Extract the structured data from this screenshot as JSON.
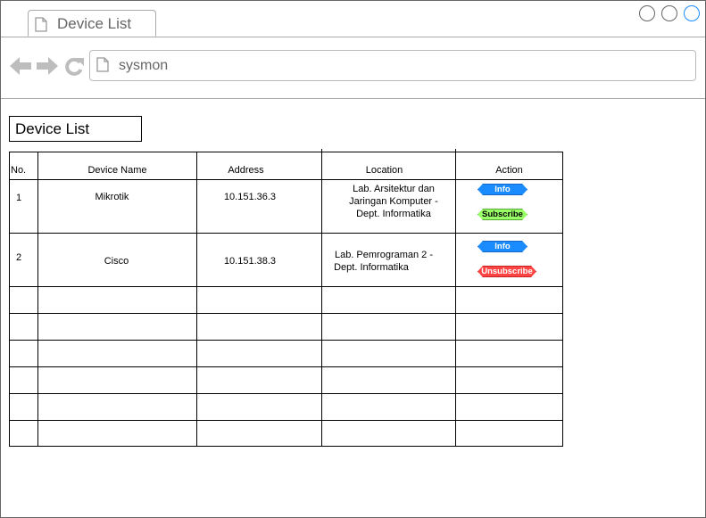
{
  "browser": {
    "tab_title": "Device List",
    "address": "sysmon"
  },
  "page": {
    "title": "Device List"
  },
  "table": {
    "headers": [
      "No.",
      "Device Name",
      "Address",
      "Location",
      "Action"
    ],
    "rows": [
      {
        "no": "1",
        "name": "Mikrotik",
        "address": "10.151.36.3",
        "location": [
          "Lab. Arsitektur dan",
          "Jaringan Komputer -",
          "Dept. Informatika"
        ],
        "actions": [
          {
            "label": "Info",
            "color": "#1a8cff"
          },
          {
            "label": "Subscribe",
            "color": "#99ff66"
          }
        ]
      },
      {
        "no": "2",
        "name": "Cisco",
        "address": "10.151.38.3",
        "location": [
          "Lab. Pemrograman 2 -",
          "Dept. Informatika"
        ],
        "actions": [
          {
            "label": "Info",
            "color": "#1a8cff"
          },
          {
            "label": "Unsubscribe",
            "color": "#ff4444"
          }
        ]
      }
    ]
  }
}
